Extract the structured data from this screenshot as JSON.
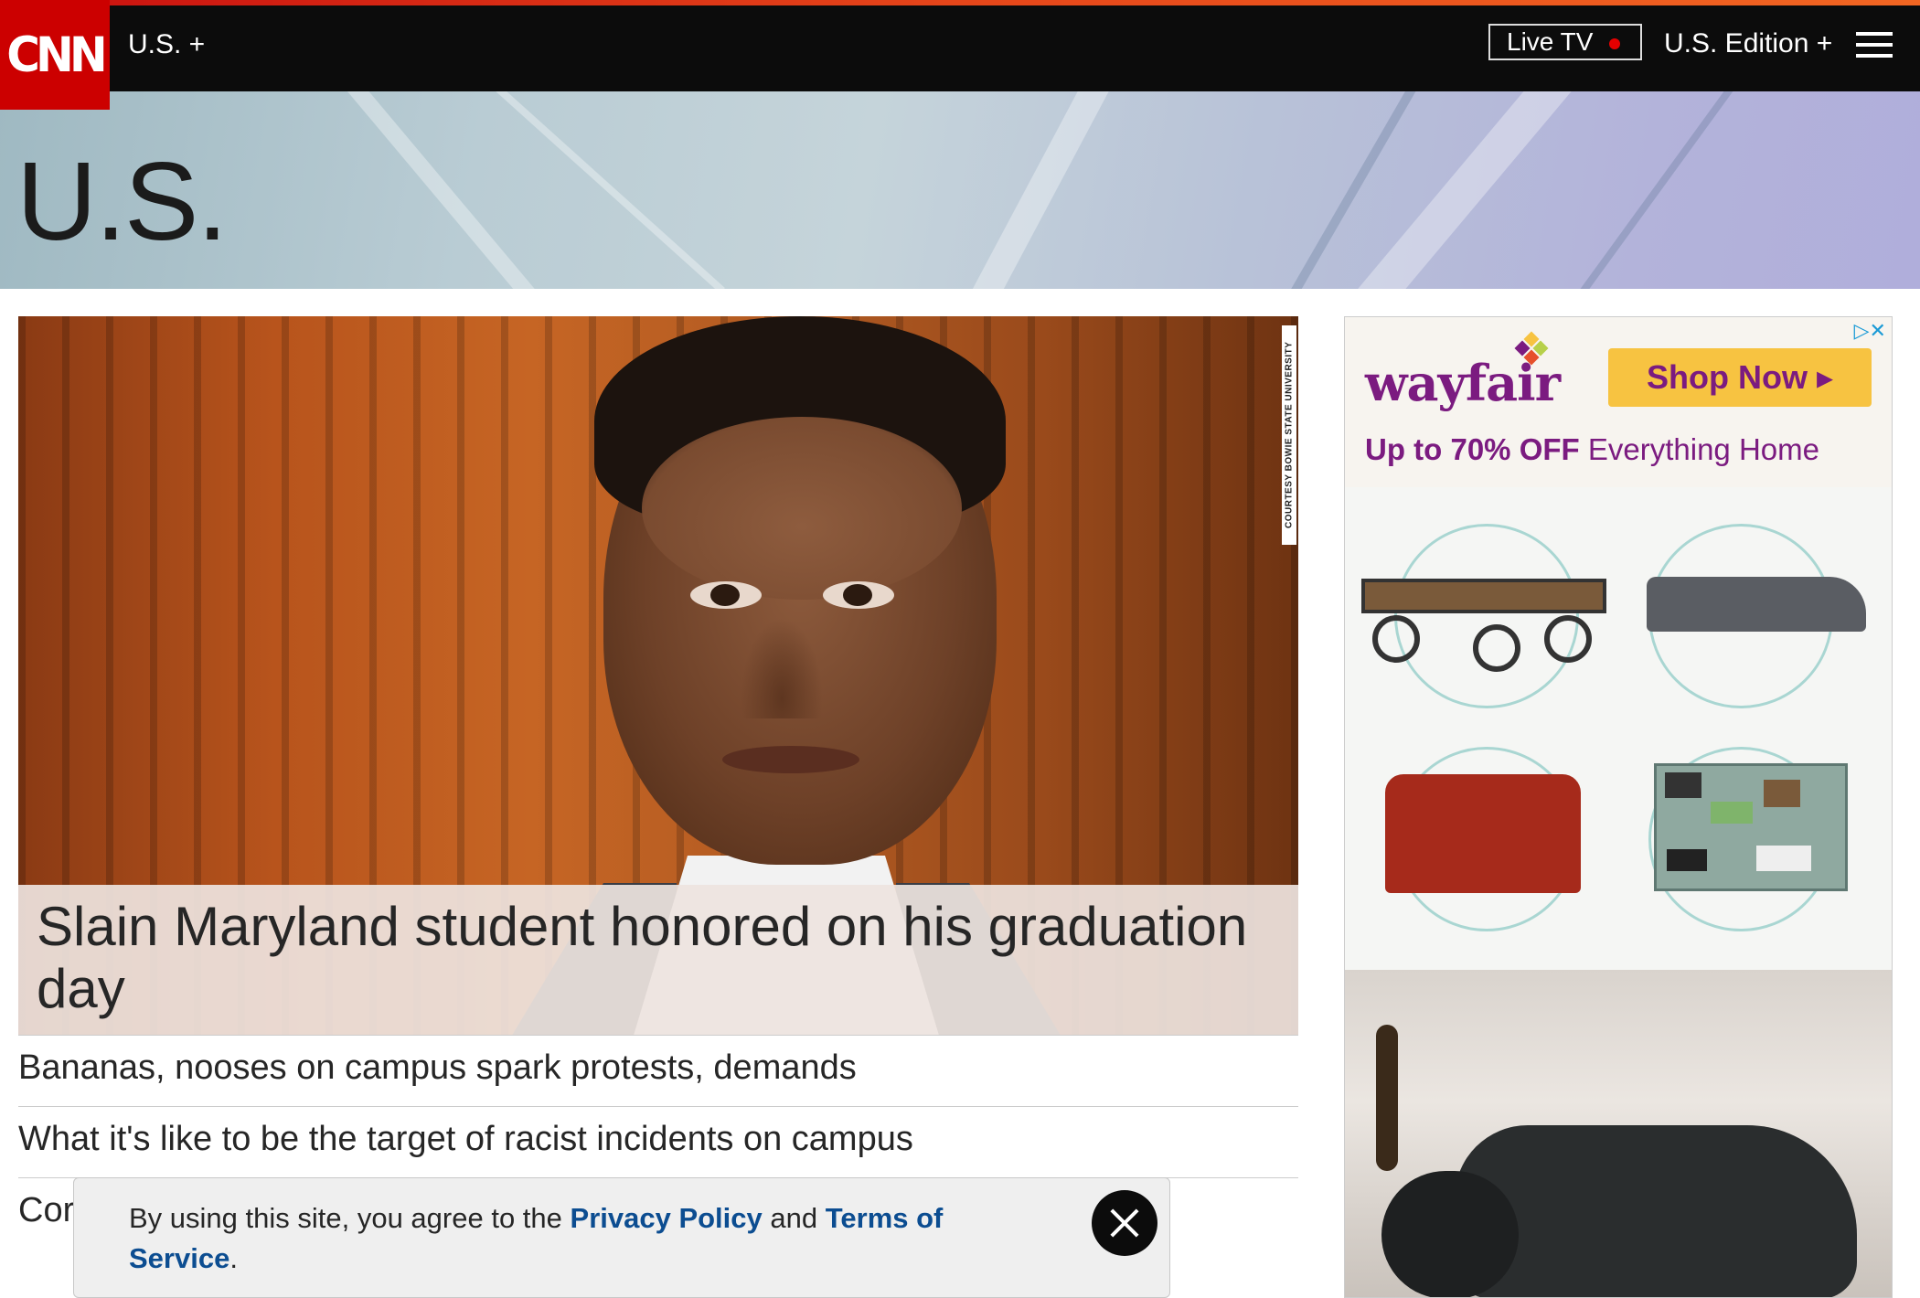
{
  "header": {
    "logo_text": "CNN",
    "section_link": "U.S. +",
    "live_tv_label": "Live TV",
    "edition_label": "U.S. Edition +"
  },
  "banner": {
    "title": "U.S."
  },
  "hero": {
    "photo_credit": "COURTESY BOWIE STATE UNIVERSITY",
    "headline": "Slain Maryland student honored on his graduation day"
  },
  "headlines": [
    "Bananas, nooses on campus spark protests, demands",
    "What it's like to be the target of racist incidents on campus",
    "Cor"
  ],
  "ad": {
    "brand": "wayfair",
    "cta": "Shop Now ▸",
    "offer_bold": "Up to 70% OFF",
    "offer_rest": "Everything Home",
    "choices": "▷✕",
    "brand_colors": {
      "primary": "#7b1b80",
      "cta_bg": "#f7c341"
    }
  },
  "cookie_notice": {
    "prefix": "By using this site, you agree to the",
    "privacy_link": "Privacy Policy",
    "and": "and",
    "terms_link": "Terms of Service",
    "suffix": "."
  },
  "colors": {
    "brand_red": "#cc0000",
    "topbar": "#0c0c0c",
    "live_dot": "#e50000",
    "link_blue": "#0c4d91"
  }
}
